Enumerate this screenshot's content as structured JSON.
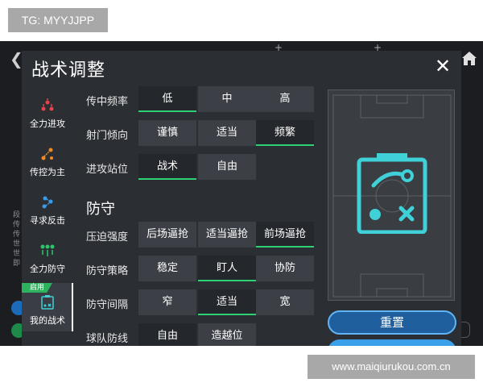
{
  "watermarks": {
    "top_left": "TG: MYYJJPP",
    "bottom_right": "www.maiqiurukou.com.cn"
  },
  "dialog": {
    "title": "战术调整",
    "close_icon": "close-icon"
  },
  "sidebar": {
    "items": [
      {
        "label": "全力进攻",
        "icon": "all-out-attack-icon"
      },
      {
        "label": "传控为主",
        "icon": "possession-icon"
      },
      {
        "label": "寻求反击",
        "icon": "counter-attack-icon"
      },
      {
        "label": "全力防守",
        "icon": "all-out-defense-icon"
      },
      {
        "label": "我的战术",
        "icon": "my-tactics-icon",
        "badge": "启用",
        "active": true
      }
    ]
  },
  "attack": {
    "rows": [
      {
        "label": "传中频率",
        "options": [
          "低",
          "中",
          "高"
        ],
        "selected": 0
      },
      {
        "label": "射门倾向",
        "options": [
          "谨慎",
          "适当",
          "频繁"
        ],
        "selected": 2
      },
      {
        "label": "进攻站位",
        "options": [
          "战术",
          "自由"
        ],
        "selected": 0
      }
    ]
  },
  "defense": {
    "title": "防守",
    "rows": [
      {
        "label": "压迫强度",
        "options": [
          "后场逼抢",
          "适当逼抢",
          "前场逼抢"
        ],
        "selected": 2
      },
      {
        "label": "防守策略",
        "options": [
          "稳定",
          "盯人",
          "协防"
        ],
        "selected": 1
      },
      {
        "label": "防守间隔",
        "options": [
          "窄",
          "适当",
          "宽"
        ],
        "selected": 1
      },
      {
        "label": "球队防线",
        "options": [
          "自由",
          "造越位"
        ],
        "selected": 0
      }
    ]
  },
  "pitch": {
    "icon": "tactics-board-icon",
    "accent": "#3fd0d8"
  },
  "buttons": {
    "reset": "重置"
  },
  "colors": {
    "selected_underline": "#2fd072",
    "badge": "#2db35d",
    "reset_button": "#1f5f9e"
  }
}
